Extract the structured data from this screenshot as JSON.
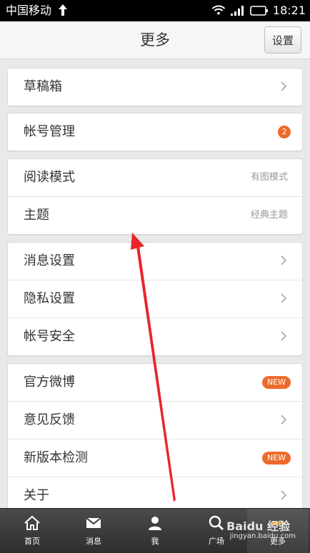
{
  "status": {
    "carrier": "中国移动",
    "time": "18:21"
  },
  "header": {
    "title": "更多",
    "settings_label": "设置"
  },
  "groups": [
    {
      "rows": [
        {
          "label": "草稿箱",
          "accessory": "chevron"
        }
      ]
    },
    {
      "rows": [
        {
          "label": "帐号管理",
          "accessory": "count",
          "badge": "2"
        }
      ]
    },
    {
      "rows": [
        {
          "label": "阅读模式",
          "accessory": "value",
          "value": "有图模式"
        },
        {
          "label": "主题",
          "accessory": "value",
          "value": "经典主题"
        }
      ]
    },
    {
      "rows": [
        {
          "label": "消息设置",
          "accessory": "chevron"
        },
        {
          "label": "隐私设置",
          "accessory": "chevron"
        },
        {
          "label": "帐号安全",
          "accessory": "chevron"
        }
      ]
    },
    {
      "rows": [
        {
          "label": "官方微博",
          "accessory": "new",
          "badge": "NEW"
        },
        {
          "label": "意见反馈",
          "accessory": "chevron"
        },
        {
          "label": "新版本检测",
          "accessory": "new",
          "badge": "NEW"
        },
        {
          "label": "关于",
          "accessory": "chevron"
        }
      ]
    }
  ],
  "tabs": [
    {
      "label": "首页",
      "icon": "home-icon"
    },
    {
      "label": "消息",
      "icon": "message-icon"
    },
    {
      "label": "我",
      "icon": "profile-icon"
    },
    {
      "label": "广场",
      "icon": "search-icon"
    },
    {
      "label": "更多",
      "icon": "more-icon"
    }
  ],
  "watermark": {
    "text": "Baidu 经验",
    "sub": "jingyan.baidu.com"
  },
  "colors": {
    "badge": "#ee6a2a",
    "annotation_arrow": "#e8252b"
  }
}
